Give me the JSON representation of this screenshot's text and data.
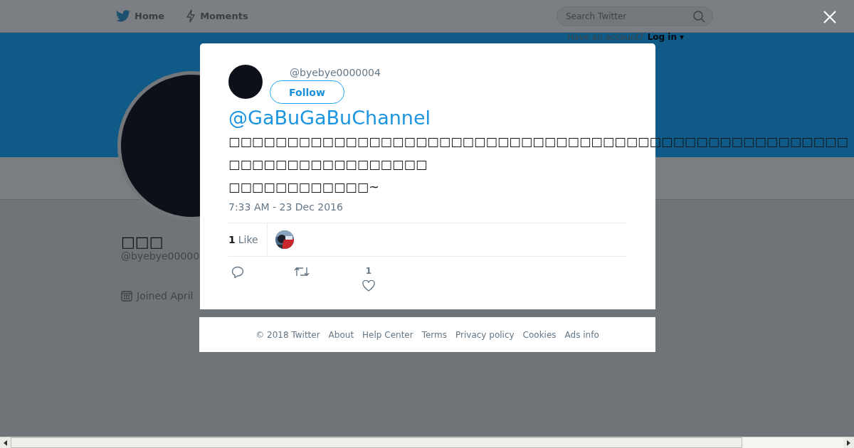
{
  "nav": {
    "items": [
      {
        "label": "Home",
        "kind": "bird"
      },
      {
        "label": "Moments",
        "kind": "bolt"
      }
    ],
    "search": {
      "placeholder": "Search Twitter"
    },
    "login": {
      "prompt": "Have an account?",
      "link": "Log in ▾"
    }
  },
  "profile": {
    "name": "□□□",
    "handle": "@byebye00000",
    "joined": "Joined April"
  },
  "tweet": {
    "handle": "@byebye0000004",
    "follow": "Follow",
    "mention": "@GaBuGaBuChannel",
    "lines": [
      "□□□□□□□□□□□□□□□□□□□□□□□□□□□□□□□□□□□□□□□□□□□□□□□□□□□□□",
      "□□□□□□□□□□□□□□□□□",
      "□□□□□□□□□□□□~"
    ],
    "time": "7:33 AM - 23 Dec 2016",
    "likes": {
      "count": "1",
      "label": "Like"
    },
    "actions": [
      {
        "kind": "reply"
      },
      {
        "kind": "retweet"
      },
      {
        "kind": "like",
        "count": "1"
      }
    ]
  },
  "footer": [
    "© 2018 Twitter",
    "About",
    "Help Center",
    "Terms",
    "Privacy policy",
    "Cookies",
    "Ads info"
  ]
}
